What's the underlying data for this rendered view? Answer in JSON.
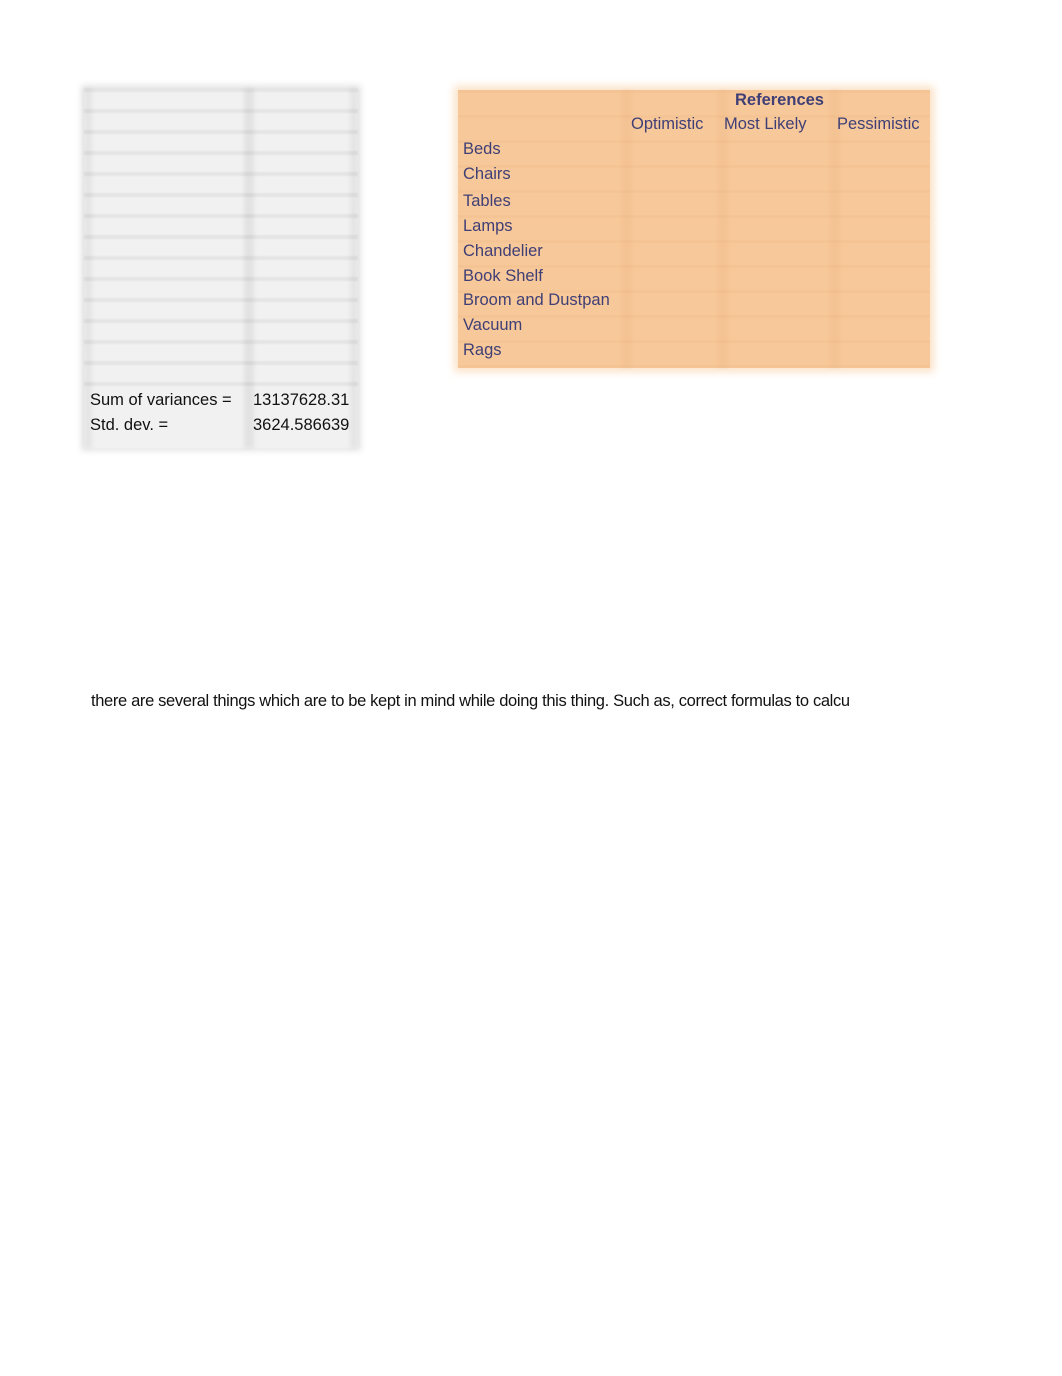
{
  "stats": {
    "sum_of_variances_label": "Sum of variances =",
    "sum_of_variances_value": "13137628.31",
    "std_dev_label": "Std. dev. =",
    "std_dev_value": "3624.586639"
  },
  "references": {
    "title": "References",
    "columns": [
      "Optimistic",
      "Most Likely",
      "Pessimistic"
    ],
    "rows": [
      "Beds",
      "Chairs",
      "Tables",
      "Lamps",
      "Chandelier",
      "Book Shelf",
      "Broom and Dustpan",
      "Vacuum",
      "Rags"
    ]
  },
  "paragraph": "there are several things which are to be kept in mind while doing this thing. Such as, correct formulas to calcu",
  "colors": {
    "reference_fill": "#f7c899",
    "reference_text": "#3f3f76",
    "grey_fill": "#f1f1f1"
  }
}
